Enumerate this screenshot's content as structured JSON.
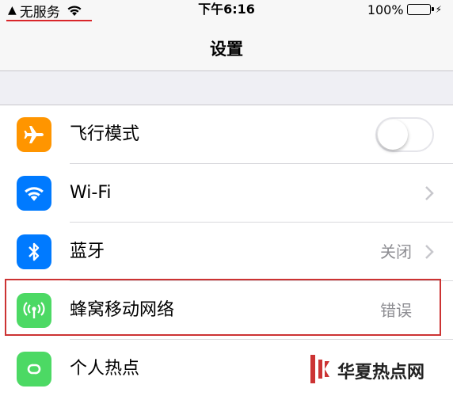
{
  "status_bar": {
    "carrier": "无服务",
    "time": "下午6:16",
    "battery_percent": "100%",
    "battery_level": 1.0,
    "icons": [
      "warning-icon",
      "wifi-icon",
      "battery-icon",
      "charging-bolt-icon"
    ]
  },
  "nav": {
    "title": "设置"
  },
  "settings": {
    "items": [
      {
        "label": "飞行模式",
        "icon": "airplane-icon",
        "color": "#ff9500",
        "control": "toggle",
        "toggle_on": false
      },
      {
        "label": "Wi-Fi",
        "icon": "wifi-icon",
        "color": "#007aff",
        "control": "chevron"
      },
      {
        "label": "蓝牙",
        "icon": "bluetooth-icon",
        "color": "#007aff",
        "value": "关闭",
        "control": "chevron"
      },
      {
        "label": "蜂窝移动网络",
        "icon": "cellular-antenna-icon",
        "color": "#4cd964",
        "value": "错误",
        "control": "none"
      },
      {
        "label": "个人热点",
        "icon": "hotspot-link-icon",
        "color": "#4cd964",
        "control": "none"
      }
    ]
  },
  "watermark": {
    "text": "华夏热点网",
    "brand_color": "#cc3333"
  },
  "colors": {
    "highlight": "#cc3333",
    "carrier_underline": "#d9262a"
  }
}
